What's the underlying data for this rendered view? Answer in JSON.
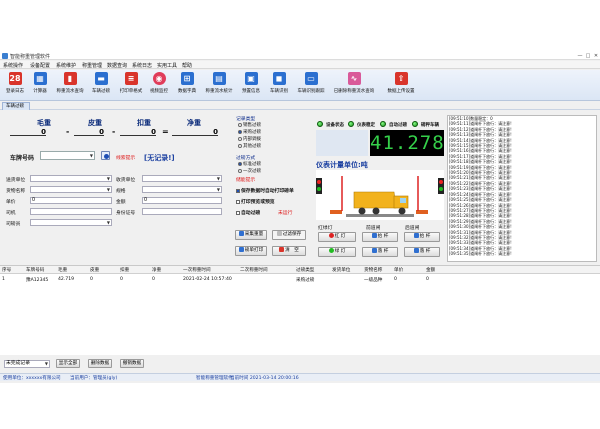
{
  "window": {
    "title": "智能称重管理软件",
    "controls": [
      "—",
      "□",
      "✕"
    ]
  },
  "menu": [
    "系统操作",
    "设备配置",
    "系统维护",
    "称重管理",
    "数据查询",
    "系统日志",
    "实用工具",
    "帮助"
  ],
  "toolbar": [
    {
      "label": "登录日志",
      "icon": "calendar-icon",
      "color": "#d9342b",
      "glyph": "28"
    },
    {
      "label": "计算器",
      "icon": "calculator-icon",
      "color": "#2b6fd0",
      "glyph": "▦"
    },
    {
      "label": "称重流水查询",
      "icon": "bar-chart-icon",
      "color": "#d9342b",
      "glyph": "▮"
    },
    {
      "label": "车辆过磅",
      "icon": "truck-icon",
      "color": "#2b6fd0",
      "glyph": "▬"
    },
    {
      "label": "打印单格式",
      "icon": "print-form-icon",
      "color": "#d9342b",
      "glyph": "≡"
    },
    {
      "label": "视频监控",
      "icon": "camera-icon",
      "color": "#e03c5a",
      "glyph": "◉"
    },
    {
      "label": "数据字典",
      "icon": "dictionary-icon",
      "color": "#2b6fd0",
      "glyph": "⊞"
    },
    {
      "label": "称重流水统计",
      "icon": "statistics-icon",
      "color": "#2b6fd0",
      "glyph": "▤"
    },
    {
      "label": "预置信息",
      "icon": "preset-icon",
      "color": "#2b6fd0",
      "glyph": "▣"
    },
    {
      "label": "车辆识别",
      "icon": "plate-recognition-icon",
      "color": "#2b6fd0",
      "glyph": "◼"
    },
    {
      "label": "车辆识别跟踪",
      "icon": "tracking-icon",
      "color": "#2b6fd0",
      "glyph": "▭"
    },
    {
      "label": "已删除称重流水查询",
      "icon": "deleted-records-icon",
      "color": "#d95a9a",
      "glyph": "∿"
    },
    {
      "label": "数据上传设置",
      "icon": "upload-icon",
      "color": "#d9342b",
      "glyph": "⇧"
    }
  ],
  "tab": {
    "label": "车辆过磅"
  },
  "weighing": {
    "gross_label": "毛重",
    "tare_label": "皮重",
    "deduct_label": "扣重",
    "net_label": "净重",
    "gross": "0",
    "tare": "0",
    "deduct": "0",
    "net": "0",
    "minus": "-",
    "equals": "="
  },
  "plate": {
    "label": "车牌号码",
    "value": "",
    "note": "线索提示",
    "unrecorded": "[无记录!]"
  },
  "form": {
    "consignor_label": "送货单位",
    "consignor": "",
    "receiver_label": "收货单位",
    "receiver": "",
    "cargo_label": "货物名称",
    "cargo": "",
    "spec_label": "规格",
    "spec": "",
    "price_label": "单价",
    "price": "0",
    "amount_label": "金额",
    "amount": "0",
    "driver_label": "司机",
    "driver": "",
    "driver_id_label": "身份证号",
    "driver_id": "",
    "operator_label": "司磅员",
    "operator": ""
  },
  "options": {
    "record_type_title": "记录类型",
    "record_types": [
      "销售过磅",
      "采购过磅",
      "内部调拨",
      "其他过磅"
    ],
    "record_type_selected": 1,
    "weigh_mode_title": "过磅方式",
    "weigh_modes": [
      "标准过磅",
      "一次过磅"
    ],
    "weigh_mode_selected": 0,
    "save_print_label": "保存数据时自动打印磅单",
    "save_print_checked": true,
    "print_preview_label": "打印预览或预览",
    "print_preview_checked": false,
    "auto_weigh_label": "自动过磅",
    "auto_weigh_checked": false,
    "auto_weigh_status": "未运行",
    "hint_label": "储能提示",
    "capture_button": "采集重量",
    "filter_button": "过滤保存",
    "plate_print_button": "磅单打印",
    "clear_button": "清　空"
  },
  "indicators": [
    {
      "label": "设备状态"
    },
    {
      "label": "仪表稳定"
    },
    {
      "label": "自动过磅"
    },
    {
      "label": "磅秤车辆"
    }
  ],
  "display": {
    "value": "41.278",
    "unit_caption": "仪表计量单位:吨"
  },
  "gates": {
    "light_label": "红绿灯",
    "front_label": "前道闸",
    "back_label": "后道闸",
    "red_label": "红 灯",
    "green_label": "绿 灯",
    "raise_label": "抬 杆",
    "lower_label": "落 杆"
  },
  "log": [
    "[09:51:10]数量稳定：0",
    "[09:51:11]道闸杆下放行：请注意!",
    "[09:51:12]道闸杆下放行：请注意!",
    "[09:51:13]道闸杆下放行：请注意!",
    "[09:51:14]道闸杆下放行：请注意!",
    "[09:51:15]道闸杆下放行：请注意!",
    "[09:51:16]道闸杆下放行：请注意!",
    "[09:51:17]道闸杆下放行：请注意!",
    "[09:51:18]道闸杆下放行：请注意!",
    "[09:51:19]道闸杆下放行：请注意!",
    "[09:51:20]道闸杆下放行：请注意!",
    "[09:51:21]道闸杆下放行：请注意!",
    "[09:51:22]道闸杆下放行：请注意!",
    "[09:51:23]道闸杆下放行：请注意!",
    "[09:51:24]道闸杆下放行：请注意!",
    "[09:51:25]道闸杆下放行：请注意!",
    "[09:51:26]道闸杆下放行：请注意!",
    "[09:51:27]道闸杆下放行：请注意!",
    "[09:51:28]道闸杆下放行：请注意!",
    "[09:51:29]道闸杆下放行：请注意!",
    "[09:51:30]道闸杆下放行：请注意!",
    "[09:51:31]道闸杆下放行：请注意!",
    "[09:51:32]道闸杆下放行：请注意!",
    "[09:51:33]道闸杆下放行：请注意!",
    "[09:51:34]道闸杆下放行：请注意!",
    "[09:51:35]道闸杆下放行：请注意!"
  ],
  "table": {
    "columns": [
      "序号",
      "车牌号码",
      "毛重",
      "皮重",
      "扣重",
      "净重",
      "一次称重时间",
      "二次称重时间",
      "过磅类型",
      "发货单位",
      "货物名称",
      "单价",
      "金额"
    ],
    "rows": [
      [
        "1",
        "豫A12345",
        "42.719",
        "0",
        "0",
        "0",
        "2021-02-24 10:57:40",
        "",
        "采购过磅",
        "",
        "一级品种",
        "0",
        "0"
      ]
    ]
  },
  "bottom": {
    "filter_select": "未完成记录",
    "show_all": "显示全部",
    "delete_data": "删除数据",
    "reweigh": "撤销数据"
  },
  "status": {
    "company": "使用单位：xxxxxx有限公司",
    "user": "当前用户：管理员(gly)",
    "software": "智能称重管理软件",
    "time": "当前时间 2021-03-14 20:00:16"
  }
}
